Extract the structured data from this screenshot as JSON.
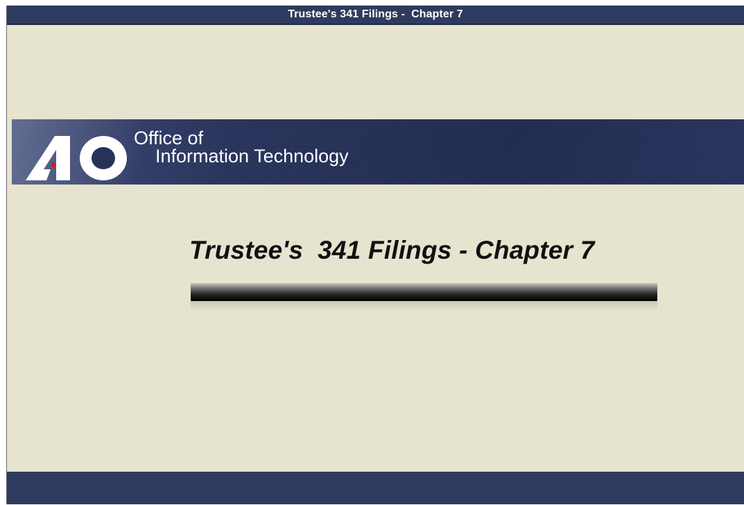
{
  "window": {
    "title": "Trustee's 341 Filings -  Chapter 7"
  },
  "banner": {
    "logo_icon": "ao-logo-icon",
    "line1": "Office of",
    "line2": "Information Technology"
  },
  "slide": {
    "title": "Trustee's  341 Filings - Chapter 7"
  },
  "colors": {
    "title_bar": "#2f3b5e",
    "background": "#e6e3cf",
    "banner": "#27325a",
    "logo_dot": "#e01414"
  }
}
